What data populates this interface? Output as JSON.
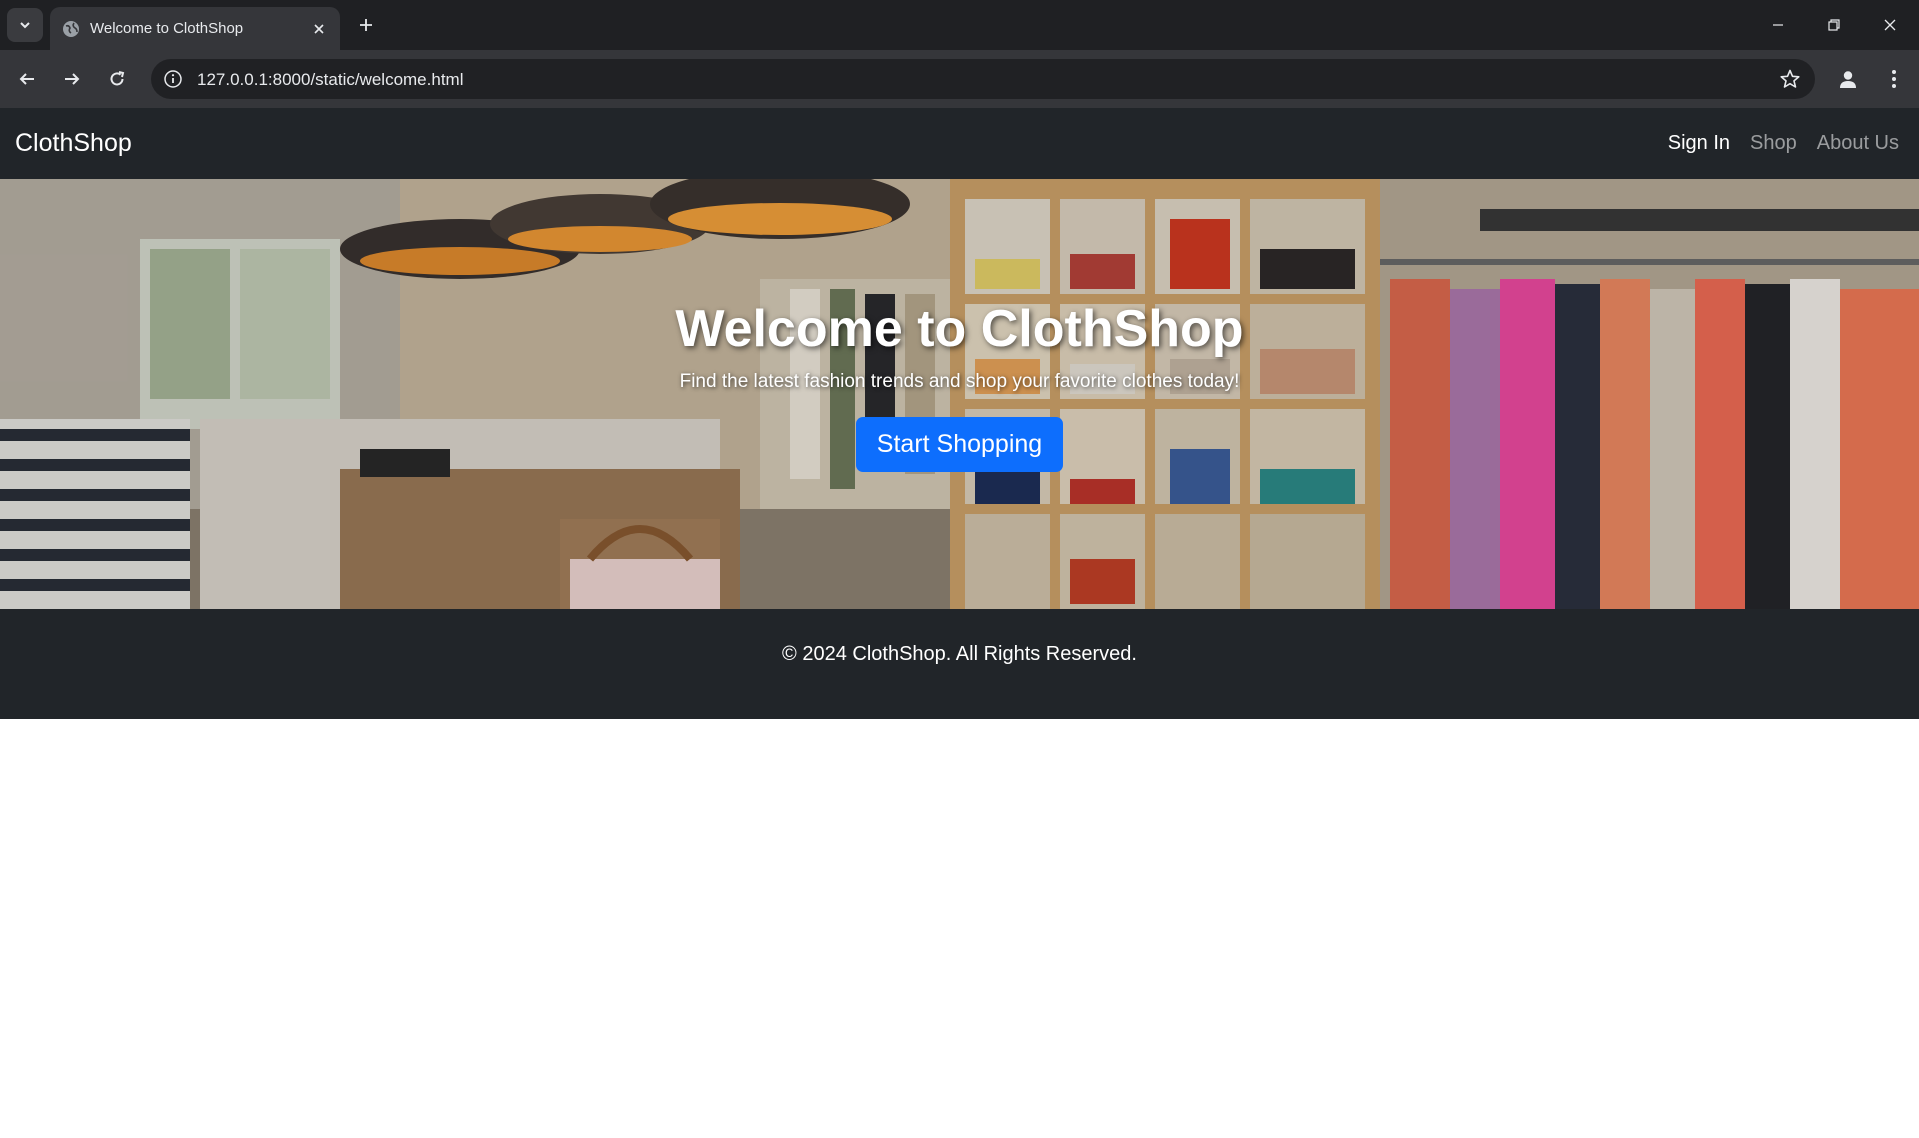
{
  "browser": {
    "tab_title": "Welcome to ClothShop",
    "url": "127.0.0.1:8000/static/welcome.html"
  },
  "navbar": {
    "brand": "ClothShop",
    "links": [
      {
        "label": "Sign In",
        "active": true
      },
      {
        "label": "Shop",
        "active": false
      },
      {
        "label": "About Us",
        "active": false
      }
    ]
  },
  "hero": {
    "title": "Welcome to ClothShop",
    "subtitle": "Find the latest fashion trends and shop your favorite clothes today!",
    "cta_label": "Start Shopping"
  },
  "footer": {
    "text": "© 2024 ClothShop. All Rights Reserved."
  },
  "colors": {
    "navbar_bg": "#212529",
    "primary_button": "#0d6efd",
    "chrome_dark": "#1f2023"
  }
}
